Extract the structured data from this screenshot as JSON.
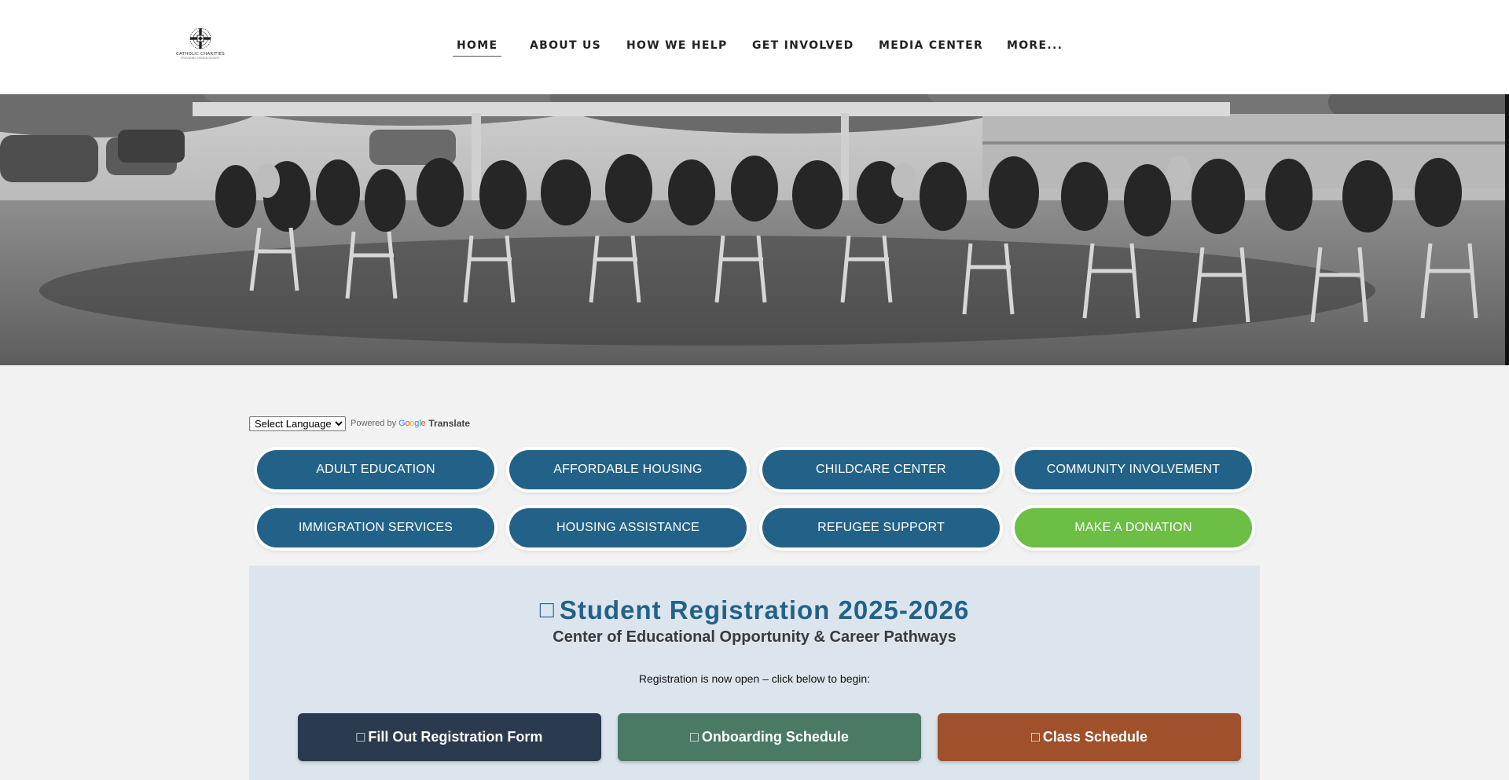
{
  "header": {
    "logo": {
      "name": "CATHOLIC CHARITIES",
      "tagline": "PROVIDING HUMAN DIGNITY"
    },
    "nav": [
      {
        "label": "HOME",
        "active": true
      },
      {
        "label": "ABOUT US"
      },
      {
        "label": "HOW WE HELP"
      },
      {
        "label": "GET INVOLVED"
      },
      {
        "label": "MEDIA CENTER"
      },
      {
        "label": "MORE..."
      }
    ]
  },
  "translate": {
    "select_value": "Select Language",
    "powered_by": "Powered by",
    "google": "Google",
    "translate_label": "Translate"
  },
  "services": [
    {
      "label": "ADULT EDUCATION"
    },
    {
      "label": "AFFORDABLE HOUSING"
    },
    {
      "label": "CHILDCARE CENTER"
    },
    {
      "label": "COMMUNITY INVOLVEMENT"
    },
    {
      "label": "IMMIGRATION SERVICES"
    },
    {
      "label": "HOUSING ASSISTANCE"
    },
    {
      "label": "REFUGEE SUPPORT"
    },
    {
      "label": "MAKE A DONATION"
    }
  ],
  "registration": {
    "title_glyph": "□",
    "title": "Student Registration 2025-2026",
    "subtitle": "Center of Educational Opportunity & Career Pathways",
    "note": "Registration is now open – click below to begin:",
    "actions": [
      {
        "glyph": "□",
        "label": "Fill Out Registration Form",
        "color": "#2b3a4e"
      },
      {
        "glyph": "□",
        "label": "Onboarding Schedule",
        "color": "#4a7a64"
      },
      {
        "glyph": "□",
        "label": "Class Schedule",
        "color": "#a0502b"
      }
    ]
  },
  "colors": {
    "primary_button": "#236288",
    "donate_button": "#6cbe45",
    "page_background": "#f2f2f2",
    "panel_background": "#dce5ee"
  }
}
